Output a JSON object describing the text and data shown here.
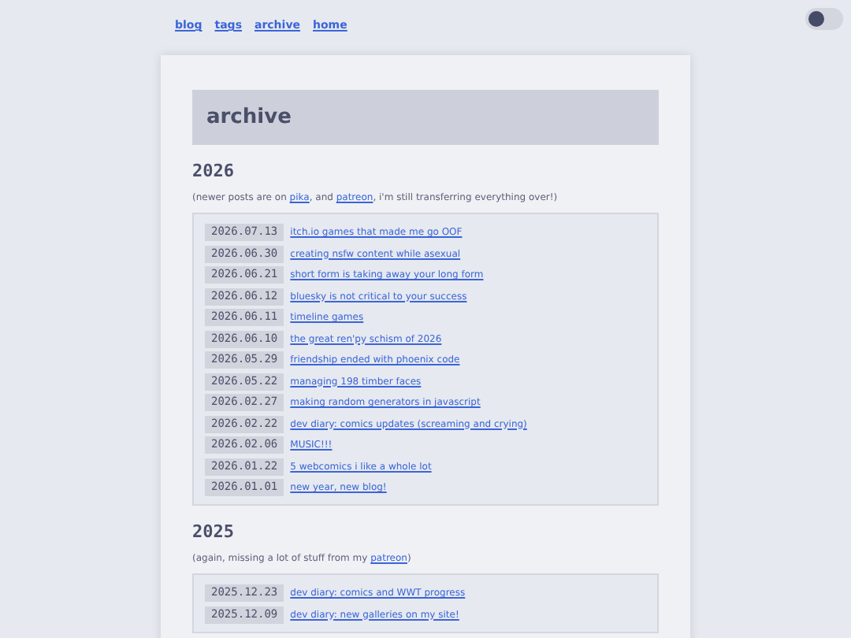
{
  "nav": [
    "blog",
    "tags",
    "archive",
    "home"
  ],
  "theme_toggle": {
    "on": false
  },
  "title": "archive",
  "years": [
    {
      "year": "2026",
      "note": [
        {
          "text": "(newer posts are on ",
          "link": false
        },
        {
          "text": "pika",
          "link": true
        },
        {
          "text": ", and ",
          "link": false
        },
        {
          "text": "patreon",
          "link": true
        },
        {
          "text": ", i'm still transferring everything over!)",
          "link": false
        }
      ],
      "posts": [
        {
          "date": "2026.07.13",
          "title": "itch.io games that made me go OOF"
        },
        {
          "date": "2026.06.30",
          "title": "creating nsfw content while asexual"
        },
        {
          "date": "2026.06.21",
          "title": "short form is taking away your long form"
        },
        {
          "date": "2026.06.12",
          "title": "bluesky is not critical to your success"
        },
        {
          "date": "2026.06.11",
          "title": "timeline games"
        },
        {
          "date": "2026.06.10",
          "title": "the great ren'py schism of 2026"
        },
        {
          "date": "2026.05.29",
          "title": "friendship ended with phoenix code"
        },
        {
          "date": "2026.05.22",
          "title": "managing 198 timber faces"
        },
        {
          "date": "2026.02.27",
          "title": "making random generators in javascript"
        },
        {
          "date": "2026.02.22",
          "title": "dev diary: comics updates (screaming and crying)"
        },
        {
          "date": "2026.02.06",
          "title": "MUSIC!!!"
        },
        {
          "date": "2026.01.22",
          "title": "5 webcomics i like a whole lot"
        },
        {
          "date": "2026.01.01",
          "title": "new year, new blog!"
        }
      ]
    },
    {
      "year": "2025",
      "note": [
        {
          "text": "(again, missing a lot of stuff from my ",
          "link": false
        },
        {
          "text": "patreon",
          "link": true
        },
        {
          "text": ")",
          "link": false
        }
      ],
      "posts": [
        {
          "date": "2025.12.23",
          "title": "dev diary: comics and WWT progress"
        },
        {
          "date": "2025.12.09",
          "title": "dev diary: new galleries on my site!"
        }
      ]
    }
  ]
}
